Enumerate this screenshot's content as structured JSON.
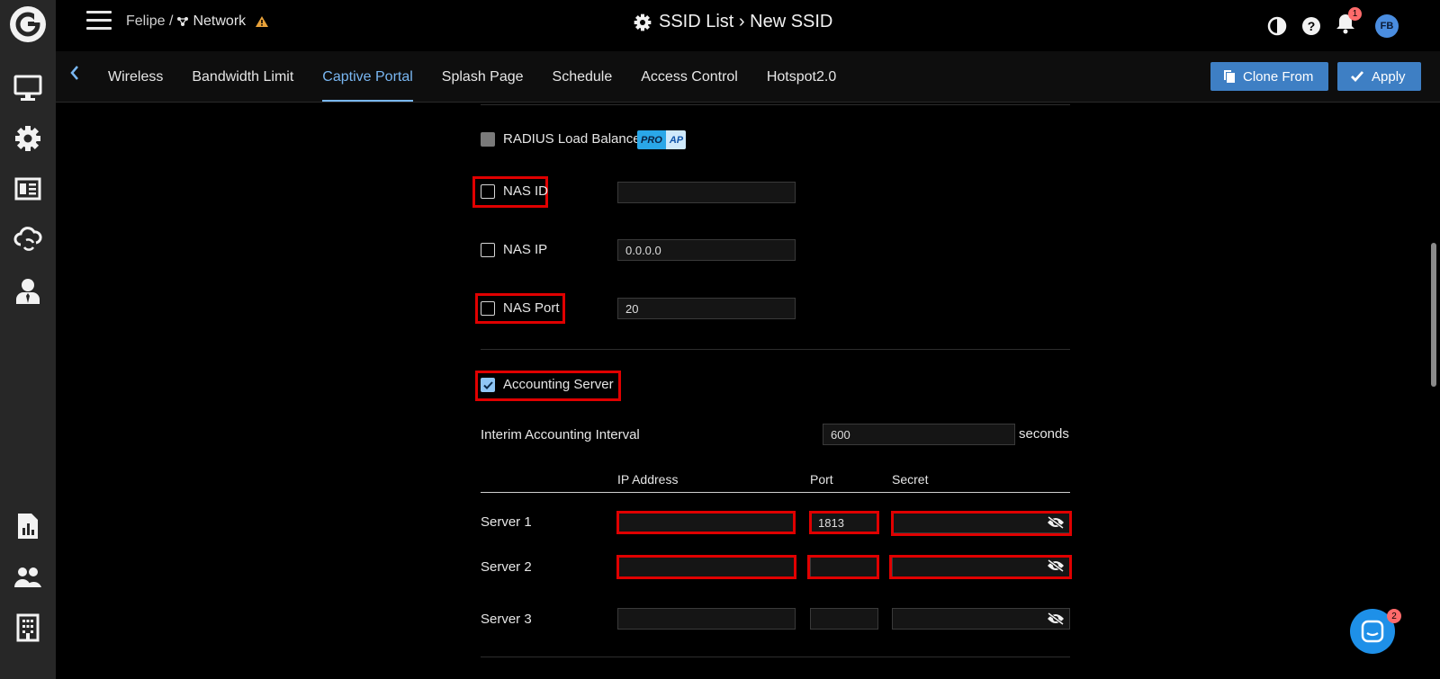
{
  "topbar": {
    "breadcrumb_org": "Felipe /",
    "breadcrumb_network": "Network",
    "page_title": "SSID List › New SSID",
    "notification_count": "1",
    "avatar_initials": "FB"
  },
  "tabs": [
    {
      "label": "Wireless"
    },
    {
      "label": "Bandwidth Limit"
    },
    {
      "label": "Captive Portal"
    },
    {
      "label": "Splash Page"
    },
    {
      "label": "Schedule"
    },
    {
      "label": "Access Control"
    },
    {
      "label": "Hotspot2.0"
    }
  ],
  "active_tab": "Captive Portal",
  "buttons": {
    "clone_from": "Clone From",
    "apply": "Apply"
  },
  "form": {
    "radius_load_balance": {
      "label": "RADIUS Load Balance",
      "badge_a": "PRO",
      "badge_b": "AP",
      "checked": false,
      "disabled": true
    },
    "nas_id": {
      "label": "NAS ID",
      "value": "",
      "checked": false
    },
    "nas_ip": {
      "label": "NAS IP",
      "value": "0.0.0.0",
      "checked": false
    },
    "nas_port": {
      "label": "NAS Port",
      "value": "20",
      "checked": false
    },
    "accounting_server": {
      "label": "Accounting Server",
      "checked": true
    },
    "interim": {
      "label": "Interim Accounting Interval",
      "value": "600",
      "unit": "seconds"
    },
    "table_headers": {
      "ip": "IP Address",
      "port": "Port",
      "secret": "Secret"
    },
    "servers": [
      {
        "label": "Server 1",
        "ip": "",
        "port": "1813",
        "secret": ""
      },
      {
        "label": "Server 2",
        "ip": "",
        "port": "",
        "secret": ""
      },
      {
        "label": "Server 3",
        "ip": "",
        "port": "",
        "secret": ""
      }
    ]
  },
  "chat": {
    "unread_count": "2"
  },
  "colors": {
    "accent": "#79b7f2",
    "button": "#3e7fc4",
    "highlight_box": "#e00000",
    "rail": "#272727",
    "badge": "#ff6b6b"
  },
  "icons": {
    "rail": [
      "monitor-icon",
      "settings-icon",
      "report-icon",
      "cloud-sync-icon",
      "admin-user-icon",
      "analytics-icon",
      "users-icon",
      "building-icon"
    ],
    "top": [
      "contrast-icon",
      "help-icon",
      "bell-icon"
    ]
  }
}
